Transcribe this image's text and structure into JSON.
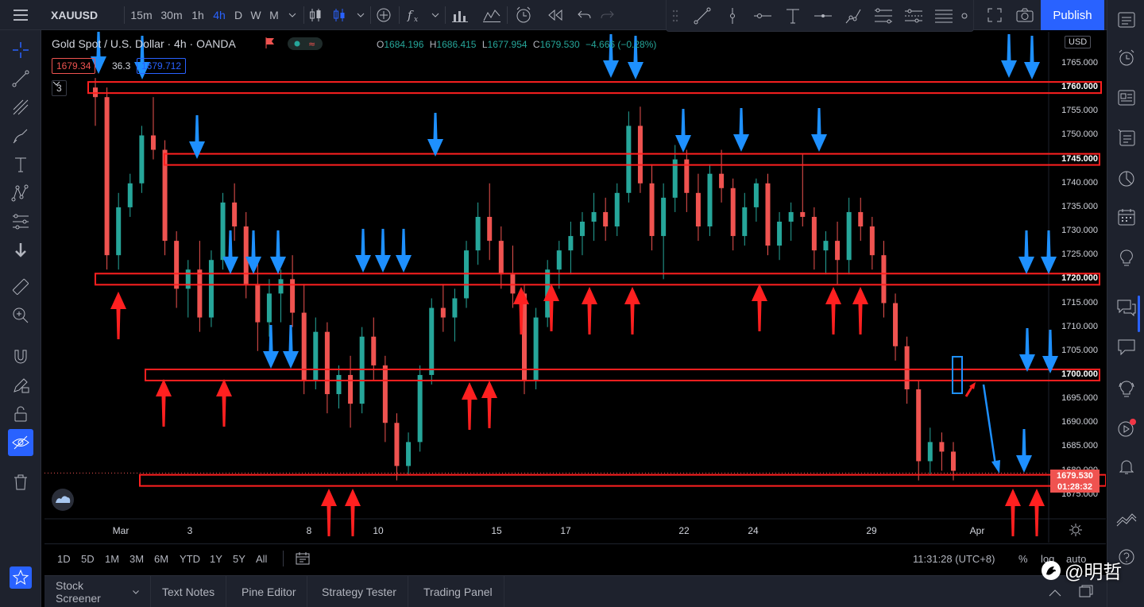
{
  "topbar": {
    "symbol": "XAUUSD",
    "intervals": [
      "15m",
      "30m",
      "1h",
      "4h",
      "D",
      "W",
      "M"
    ],
    "active_interval": "4h",
    "publish_label": "Publish"
  },
  "legend": {
    "title": "Gold Spot / U.S. Dollar · 4h · OANDA",
    "o_key": "O",
    "o": "1684.196",
    "h_key": "H",
    "h": "1686.415",
    "l_key": "L",
    "l": "1677.954",
    "c_key": "C",
    "c": "1679.530",
    "change": "−4.666 (−0.28%)",
    "bid": "1679.34",
    "spread": "36.3",
    "ask": "1679.712",
    "indicators_count": "3"
  },
  "colors": {
    "up": "#26a69a",
    "down": "#ef5350",
    "red_annotation": "#ff2020",
    "blue_annotation": "#1e90ff",
    "accent": "#2962ff"
  },
  "price_axis": {
    "currency": "USD",
    "labels": [
      "1765.000",
      "1760.000",
      "1755.000",
      "1750.000",
      "1745.000",
      "1740.000",
      "1735.000",
      "1730.000",
      "1725.000",
      "1720.000",
      "1715.000",
      "1710.000",
      "1705.000",
      "1700.000",
      "1695.000",
      "1690.000",
      "1685.000",
      "1680.000",
      "1675.000"
    ],
    "highlighted": [
      "1760.000",
      "1745.000",
      "1720.000",
      "1700.000"
    ],
    "last_price": "1679.530",
    "countdown": "01:28:32"
  },
  "time_axis": {
    "labels": [
      "Mar",
      "3",
      "8",
      "10",
      "15",
      "17",
      "22",
      "24",
      "29",
      "Apr"
    ]
  },
  "bottom_toolbar": {
    "ranges": [
      "1D",
      "5D",
      "1M",
      "3M",
      "6M",
      "YTD",
      "1Y",
      "5Y",
      "All"
    ],
    "clock": "11:31:28 (UTC+8)",
    "pct": "%",
    "log": "log",
    "auto": "auto"
  },
  "panel_tabs": [
    "Stock Screener",
    "Text Notes",
    "Pine Editor",
    "Strategy Tester",
    "Trading Panel"
  ],
  "watermark": "@明哲",
  "chart_data": {
    "type": "candlestick",
    "ylim": [
      1671,
      1769
    ],
    "annotated_levels": [
      1760,
      1745,
      1720,
      1700,
      1678
    ],
    "candles": [
      [
        1760,
        1762,
        1752,
        1758
      ],
      [
        1758,
        1760,
        1722,
        1725
      ],
      [
        1725,
        1738,
        1722,
        1735
      ],
      [
        1735,
        1742,
        1733,
        1740
      ],
      [
        1740,
        1752,
        1738,
        1750
      ],
      [
        1750,
        1758,
        1745,
        1747
      ],
      [
        1747,
        1749,
        1725,
        1728
      ],
      [
        1728,
        1730,
        1714,
        1718
      ],
      [
        1718,
        1724,
        1712,
        1722
      ],
      [
        1722,
        1728,
        1709,
        1712
      ],
      [
        1712,
        1726,
        1710,
        1724
      ],
      [
        1724,
        1738,
        1722,
        1736
      ],
      [
        1736,
        1740,
        1728,
        1731
      ],
      [
        1731,
        1734,
        1716,
        1719
      ],
      [
        1719,
        1724,
        1705,
        1711
      ],
      [
        1711,
        1720,
        1708,
        1717
      ],
      [
        1717,
        1722,
        1711,
        1720
      ],
      [
        1720,
        1725,
        1710,
        1713
      ],
      [
        1713,
        1719,
        1696,
        1699
      ],
      [
        1699,
        1712,
        1697,
        1709
      ],
      [
        1709,
        1711,
        1692,
        1696
      ],
      [
        1696,
        1702,
        1693,
        1700
      ],
      [
        1700,
        1704,
        1689,
        1694
      ],
      [
        1694,
        1710,
        1692,
        1708
      ],
      [
        1708,
        1712,
        1699,
        1702
      ],
      [
        1702,
        1704,
        1686,
        1690
      ],
      [
        1690,
        1692,
        1678,
        1681
      ],
      [
        1681,
        1688,
        1679,
        1686
      ],
      [
        1686,
        1702,
        1684,
        1700
      ],
      [
        1700,
        1716,
        1698,
        1714
      ],
      [
        1714,
        1719,
        1709,
        1712
      ],
      [
        1712,
        1718,
        1707,
        1716
      ],
      [
        1716,
        1728,
        1714,
        1726
      ],
      [
        1726,
        1736,
        1723,
        1733
      ],
      [
        1733,
        1740,
        1724,
        1728
      ],
      [
        1728,
        1731,
        1718,
        1721
      ],
      [
        1721,
        1727,
        1714,
        1717
      ],
      [
        1717,
        1719,
        1696,
        1699
      ],
      [
        1699,
        1714,
        1697,
        1712
      ],
      [
        1712,
        1724,
        1710,
        1722
      ],
      [
        1722,
        1728,
        1718,
        1726
      ],
      [
        1726,
        1732,
        1721,
        1729
      ],
      [
        1729,
        1734,
        1725,
        1732
      ],
      [
        1732,
        1738,
        1728,
        1734
      ],
      [
        1734,
        1737,
        1728,
        1731
      ],
      [
        1731,
        1740,
        1729,
        1738
      ],
      [
        1738,
        1755,
        1736,
        1752
      ],
      [
        1752,
        1756,
        1738,
        1740
      ],
      [
        1740,
        1744,
        1726,
        1729
      ],
      [
        1729,
        1740,
        1720,
        1737
      ],
      [
        1737,
        1748,
        1734,
        1745
      ],
      [
        1745,
        1747,
        1734,
        1738
      ],
      [
        1738,
        1742,
        1728,
        1731
      ],
      [
        1731,
        1744,
        1729,
        1742
      ],
      [
        1742,
        1747,
        1736,
        1739
      ],
      [
        1739,
        1741,
        1726,
        1729
      ],
      [
        1729,
        1738,
        1727,
        1735
      ],
      [
        1735,
        1741,
        1732,
        1740
      ],
      [
        1740,
        1742,
        1725,
        1727
      ],
      [
        1727,
        1734,
        1724,
        1732
      ],
      [
        1732,
        1736,
        1728,
        1734
      ],
      [
        1734,
        1746,
        1731,
        1733
      ],
      [
        1733,
        1735,
        1722,
        1726
      ],
      [
        1726,
        1730,
        1721,
        1728
      ],
      [
        1728,
        1732,
        1719,
        1724
      ],
      [
        1724,
        1737,
        1721,
        1734
      ],
      [
        1734,
        1737,
        1728,
        1731
      ],
      [
        1731,
        1733,
        1722,
        1725
      ],
      [
        1725,
        1728,
        1712,
        1715
      ],
      [
        1715,
        1717,
        1703,
        1706
      ],
      [
        1706,
        1708,
        1694,
        1697
      ],
      [
        1697,
        1699,
        1678,
        1682
      ],
      [
        1682,
        1689,
        1679,
        1686
      ],
      [
        1686,
        1688,
        1680,
        1684
      ],
      [
        1684,
        1686,
        1678,
        1680
      ]
    ]
  }
}
